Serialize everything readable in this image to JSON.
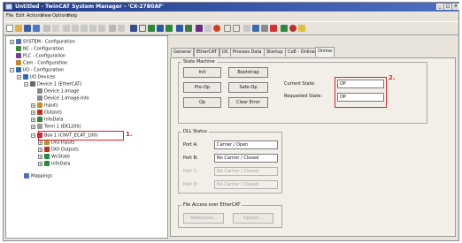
{
  "window": {
    "title": "Untitled - TwinCAT System Manager - 'CX-27B0AF'",
    "controls": [
      "_",
      "□",
      "×"
    ]
  },
  "menu": [
    "File",
    "Edit",
    "Actions",
    "View",
    "Options",
    "Help"
  ],
  "tree": [
    {
      "label": "SYSTEM - Configuration",
      "color": "#4a6fb8"
    },
    {
      "label": "NC - Configuration",
      "color": "#3a8a3a"
    },
    {
      "label": "PLC - Configuration",
      "color": "#7a3a9a"
    },
    {
      "label": "Cam - Configuration",
      "color": "#c08a2a"
    },
    {
      "label": "I/O - Configuration",
      "color": "#2a6ab0"
    },
    {
      "label": "I/O Devices",
      "color": "#2a6ab0"
    },
    {
      "label": "Device 1 (EtherCAT)",
      "color": "#6a6a6a"
    },
    {
      "label": "Device 1-Image",
      "color": "#8a8a8a"
    },
    {
      "label": "Device 1-Image-Info",
      "color": "#8a8a8a"
    },
    {
      "label": "Inputs",
      "color": "#c09020"
    },
    {
      "label": "Outputs",
      "color": "#c03020"
    },
    {
      "label": "InfoData",
      "color": "#2a8a3a"
    },
    {
      "label": "Term 1 (EK1200)",
      "color": "#9a9a9a"
    },
    {
      "label": "Box 1 (CNVT_ECAT_100)",
      "color": "#d8232a"
    },
    {
      "label": "DIO Inputs",
      "color": "#c09020"
    },
    {
      "label": "DIO Outputs",
      "color": "#c03020"
    },
    {
      "label": "WcState",
      "color": "#2a8a3a"
    },
    {
      "label": "InfoData",
      "color": "#2a8a3a"
    },
    {
      "label": "Mappings",
      "color": "#4a6fb8"
    }
  ],
  "annotations": {
    "one": "1.",
    "two": "2."
  },
  "tabs": [
    "General",
    "EtherCAT",
    "DC",
    "Process Data",
    "Startup",
    "CoE - Online",
    "Online"
  ],
  "state_machine": {
    "title": "State Machine",
    "buttons": [
      "Init",
      "Bootstrap",
      "Pre-Op",
      "Safe-Op",
      "Op",
      "Clear Error"
    ],
    "current_state_label": "Current State:",
    "current_state": "OP",
    "requested_state_label": "Requested State:",
    "requested_state": "OP"
  },
  "dll_status": {
    "title": "DLL Status",
    "ports": [
      {
        "label": "Port A:",
        "value": "Carrier / Open",
        "enabled": true
      },
      {
        "label": "Port B:",
        "value": "No Carrier / Closed",
        "enabled": true
      },
      {
        "label": "Port C:",
        "value": "No Carrier / Closed",
        "enabled": false
      },
      {
        "label": "Port D:",
        "value": "No Carrier / Closed",
        "enabled": false
      }
    ]
  },
  "file_access": {
    "title": "File Access over EtherCAT",
    "download": "Download...",
    "upload": "Upload..."
  }
}
